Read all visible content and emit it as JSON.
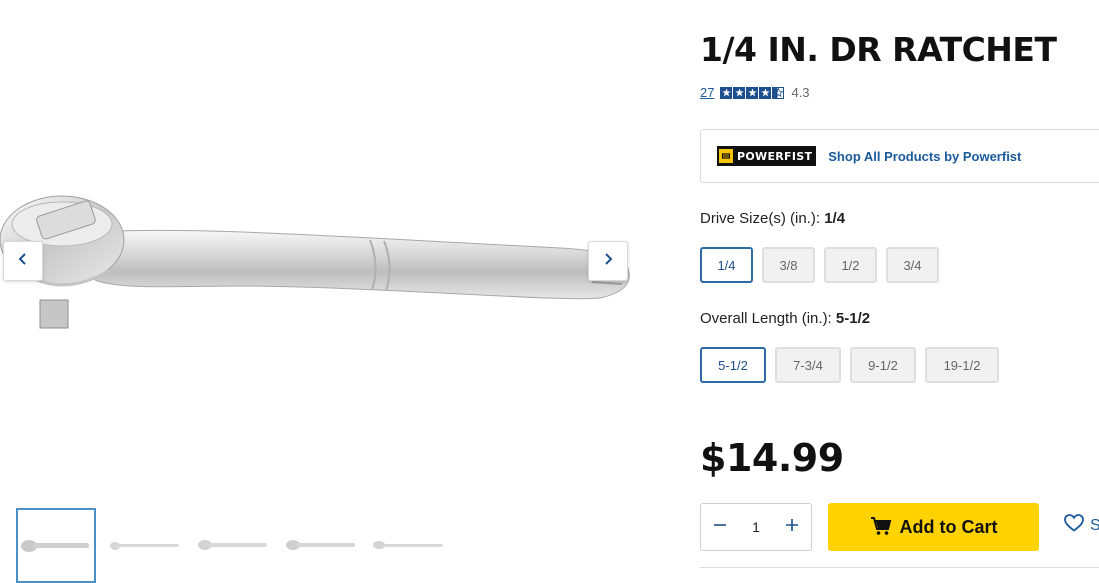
{
  "product": {
    "title": "1/4 IN. DR RATCHET",
    "review_count": "27",
    "rating_value": "4.3",
    "rating_stars": 4.3,
    "rating_max": 5
  },
  "brand": {
    "logo_text": "POWERFIST",
    "link_label": "Shop All Products by Powerfist"
  },
  "options": {
    "drive_size": {
      "label": "Drive Size(s) (in.):",
      "selected": "1/4",
      "values": [
        "1/4",
        "3/8",
        "1/2",
        "3/4"
      ]
    },
    "overall_length": {
      "label": "Overall Length (in.):",
      "selected": "5-1/2",
      "values": [
        "5-1/2",
        "7-3/4",
        "9-1/2",
        "19-1/2"
      ]
    }
  },
  "price": "$14.99",
  "cart": {
    "quantity": "1",
    "add_label": "Add to Cart"
  },
  "wishlist": {
    "label": "S"
  },
  "gallery": {
    "thumbnail_count": 5,
    "active_index": 0
  },
  "colors": {
    "accent_blue": "#1c5a9c",
    "selected_border": "#2e6aa8",
    "add_to_cart_yellow": "#ffd200",
    "star_blue": "#1c4f8c"
  },
  "icons": {
    "prev": "chevron-left-icon",
    "next": "chevron-right-icon",
    "cart": "shopping-cart-icon",
    "minus": "minus-icon",
    "plus": "plus-icon",
    "wishlist": "heart-icon",
    "star": "star-icon"
  }
}
